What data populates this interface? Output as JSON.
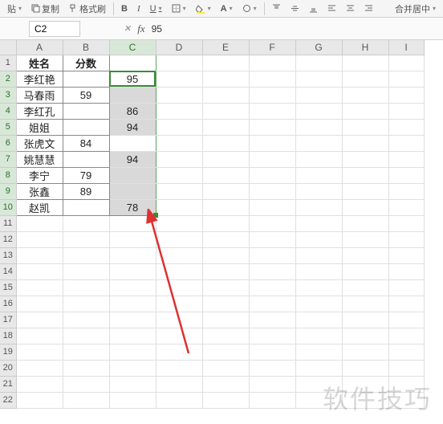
{
  "ribbon": {
    "paste": "贴",
    "copy": "复制",
    "format_painter": "格式刷",
    "merge_center": "合并居中"
  },
  "formula_bar": {
    "name_box": "C2",
    "value": "95"
  },
  "columns": [
    "A",
    "B",
    "C",
    "D",
    "E",
    "F",
    "G",
    "H",
    "I"
  ],
  "headers": {
    "name": "姓名",
    "score": "分数"
  },
  "rows": [
    {
      "name": "李红艳",
      "b": "",
      "c": "95",
      "shaded": false
    },
    {
      "name": "马春雨",
      "b": "59",
      "c": "",
      "shaded": true
    },
    {
      "name": "李红孔",
      "b": "",
      "c": "86",
      "shaded": true
    },
    {
      "name": "姐姐",
      "b": "",
      "c": "94",
      "shaded": true
    },
    {
      "name": "张虎文",
      "b": "84",
      "c": "",
      "shaded": false
    },
    {
      "name": "姚慧慧",
      "b": "",
      "c": "94",
      "shaded": true
    },
    {
      "name": "李宁",
      "b": "79",
      "c": "",
      "shaded": true
    },
    {
      "name": "张鑫",
      "b": "89",
      "c": "",
      "shaded": true
    },
    {
      "name": "赵凯",
      "b": "",
      "c": "78",
      "shaded": true
    }
  ],
  "active_cell": "C2",
  "selected_col": "C",
  "watermark": "软件技巧",
  "chart_data": {
    "type": "table",
    "title": "",
    "columns": [
      "姓名",
      "分数",
      "C"
    ],
    "data": [
      [
        "李红艳",
        null,
        95
      ],
      [
        "马春雨",
        59,
        null
      ],
      [
        "李红孔",
        null,
        86
      ],
      [
        "姐姐",
        null,
        94
      ],
      [
        "张虎文",
        84,
        null
      ],
      [
        "姚慧慧",
        null,
        94
      ],
      [
        "李宁",
        79,
        null
      ],
      [
        "张鑫",
        89,
        null
      ],
      [
        "赵凯",
        null,
        78
      ]
    ]
  }
}
